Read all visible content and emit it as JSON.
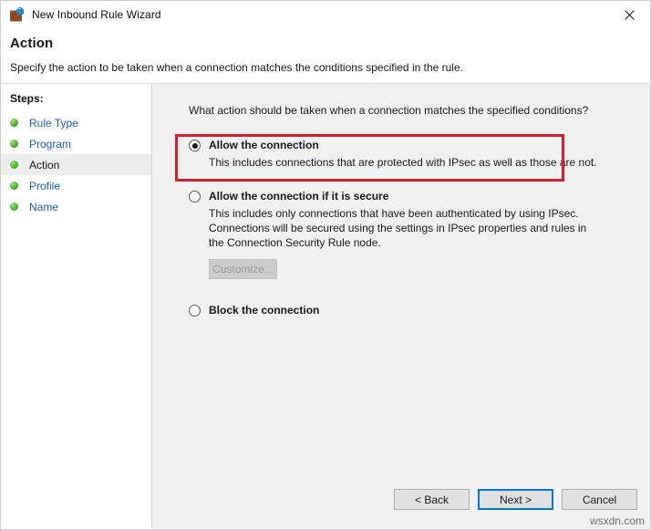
{
  "window": {
    "title": "New Inbound Rule Wizard",
    "icon": "firewall-brick-globe-icon",
    "close_label": "✕"
  },
  "header": {
    "title": "Action",
    "subtitle": "Specify the action to be taken when a connection matches the conditions specified in the rule."
  },
  "sidebar": {
    "heading": "Steps:",
    "items": [
      {
        "label": "Rule Type",
        "current": false
      },
      {
        "label": "Program",
        "current": false
      },
      {
        "label": "Action",
        "current": true
      },
      {
        "label": "Profile",
        "current": false
      },
      {
        "label": "Name",
        "current": false
      }
    ]
  },
  "main": {
    "question": "What action should be taken when a connection matches the specified conditions?",
    "options": [
      {
        "title": "Allow the connection",
        "description": "This includes connections that are protected with IPsec as well as those are not.",
        "selected": true
      },
      {
        "title": "Allow the connection if it is secure",
        "description": "This includes only connections that have been authenticated by using IPsec.  Connections will be secured using the settings in IPsec properties and rules in the Connection Security Rule node.",
        "selected": false,
        "button_label": "Customize...",
        "button_disabled": true
      },
      {
        "title": "Block the connection",
        "description": "",
        "selected": false
      }
    ]
  },
  "footer": {
    "back_label": "< Back",
    "next_label": "Next >",
    "cancel_label": "Cancel"
  },
  "watermark": "wsxdn.com",
  "colors": {
    "accent": "#0078d7",
    "annotation": "#d32030",
    "link": "#1f5fbf",
    "step_bullet": "#56b93a"
  }
}
